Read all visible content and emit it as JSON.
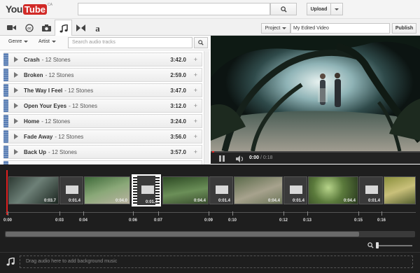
{
  "header": {
    "logo_you": "You",
    "logo_tube": "Tube",
    "logo_cc": "CA",
    "upload_label": "Upload"
  },
  "tabs": [
    "video-camera-icon",
    "cc-icon",
    "photo-camera-icon",
    "music-note-icon",
    "transitions-icon",
    "text-icon"
  ],
  "project": {
    "project_label": "Project",
    "name_value": "My Edited Video",
    "publish_label": "Publish"
  },
  "audio": {
    "genre_label": "Genre",
    "artist_label": "Artist",
    "search_placeholder": "Search audio tracks",
    "tracks": [
      {
        "name": "Crash",
        "artist": "- 12 Stones",
        "duration": "3:42.0"
      },
      {
        "name": "Broken",
        "artist": "- 12 Stones",
        "duration": "2:59.0"
      },
      {
        "name": "The Way I Feel",
        "artist": "- 12 Stones",
        "duration": "3:47.0"
      },
      {
        "name": "Open Your Eyes",
        "artist": "- 12 Stones",
        "duration": "3:12.0"
      },
      {
        "name": "Home",
        "artist": "- 12 Stones",
        "duration": "3:24.0"
      },
      {
        "name": "Fade Away",
        "artist": "- 12 Stones",
        "duration": "3:56.0"
      },
      {
        "name": "Back Up",
        "artist": "- 12 Stones",
        "duration": "3:57.0"
      }
    ]
  },
  "player": {
    "time_current": "0:00",
    "time_total": "/ 0:18"
  },
  "timeline": {
    "clip_labels": [
      "0:03.7",
      "0:01.4",
      "0:04.0",
      "0:01.4",
      "0:04.4",
      "0:01.4",
      "0:04.4",
      "0:01.4",
      "0:04.4",
      "0:01.4"
    ],
    "tick_labels": [
      "0:00",
      "0:03",
      "0:04",
      "0:06",
      "0:07",
      "0:09",
      "0:10",
      "0:12",
      "0:13",
      "0:15",
      "0:16"
    ],
    "drop_hint": "Drag audio here to add background music"
  },
  "colors": {
    "brand_red": "#d12a27",
    "grip_blue": "#5b7fb5",
    "playhead_red": "#e02020"
  }
}
